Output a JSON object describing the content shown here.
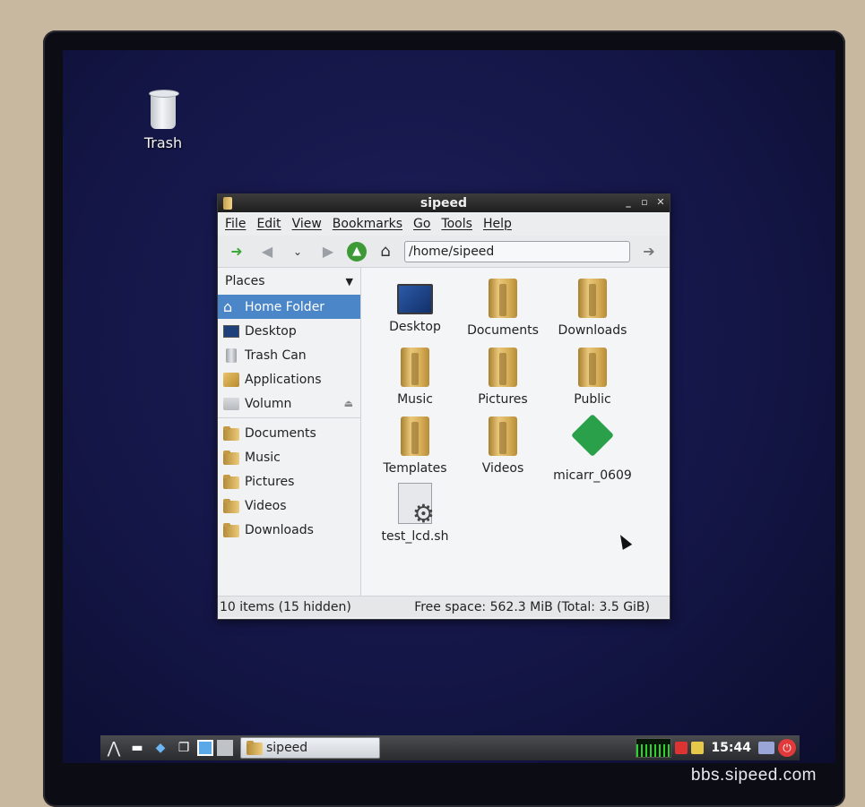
{
  "desktop": {
    "trash_label": "Trash"
  },
  "window": {
    "title": "sipeed",
    "menu": [
      "File",
      "Edit",
      "View",
      "Bookmarks",
      "Go",
      "Tools",
      "Help"
    ],
    "path": "/home/sipeed",
    "places_header": "Places",
    "places": [
      {
        "label": "Home Folder",
        "icon": "home-icon",
        "selected": true
      },
      {
        "label": "Desktop",
        "icon": "desktop-icon"
      },
      {
        "label": "Trash Can",
        "icon": "trash-icon"
      },
      {
        "label": "Applications",
        "icon": "applications-icon"
      },
      {
        "label": "Volumn",
        "icon": "drive-icon"
      }
    ],
    "bookmarks": [
      "Documents",
      "Music",
      "Pictures",
      "Videos",
      "Downloads"
    ],
    "files": [
      {
        "name": "Desktop",
        "type": "desktop"
      },
      {
        "name": "Documents",
        "type": "folder"
      },
      {
        "name": "Downloads",
        "type": "folder"
      },
      {
        "name": "Music",
        "type": "folder"
      },
      {
        "name": "Pictures",
        "type": "folder"
      },
      {
        "name": "Public",
        "type": "folder"
      },
      {
        "name": "Templates",
        "type": "folder"
      },
      {
        "name": "Videos",
        "type": "folder"
      },
      {
        "name": "micarr_0609",
        "type": "package"
      },
      {
        "name": "test_lcd.sh",
        "type": "script"
      }
    ],
    "status_left": "10 items (15 hidden)",
    "status_right": "Free space: 562.3 MiB (Total: 3.5 GiB)"
  },
  "taskbar": {
    "task_label": "sipeed",
    "clock": "15:44"
  },
  "watermark": "bbs.sipeed.com"
}
